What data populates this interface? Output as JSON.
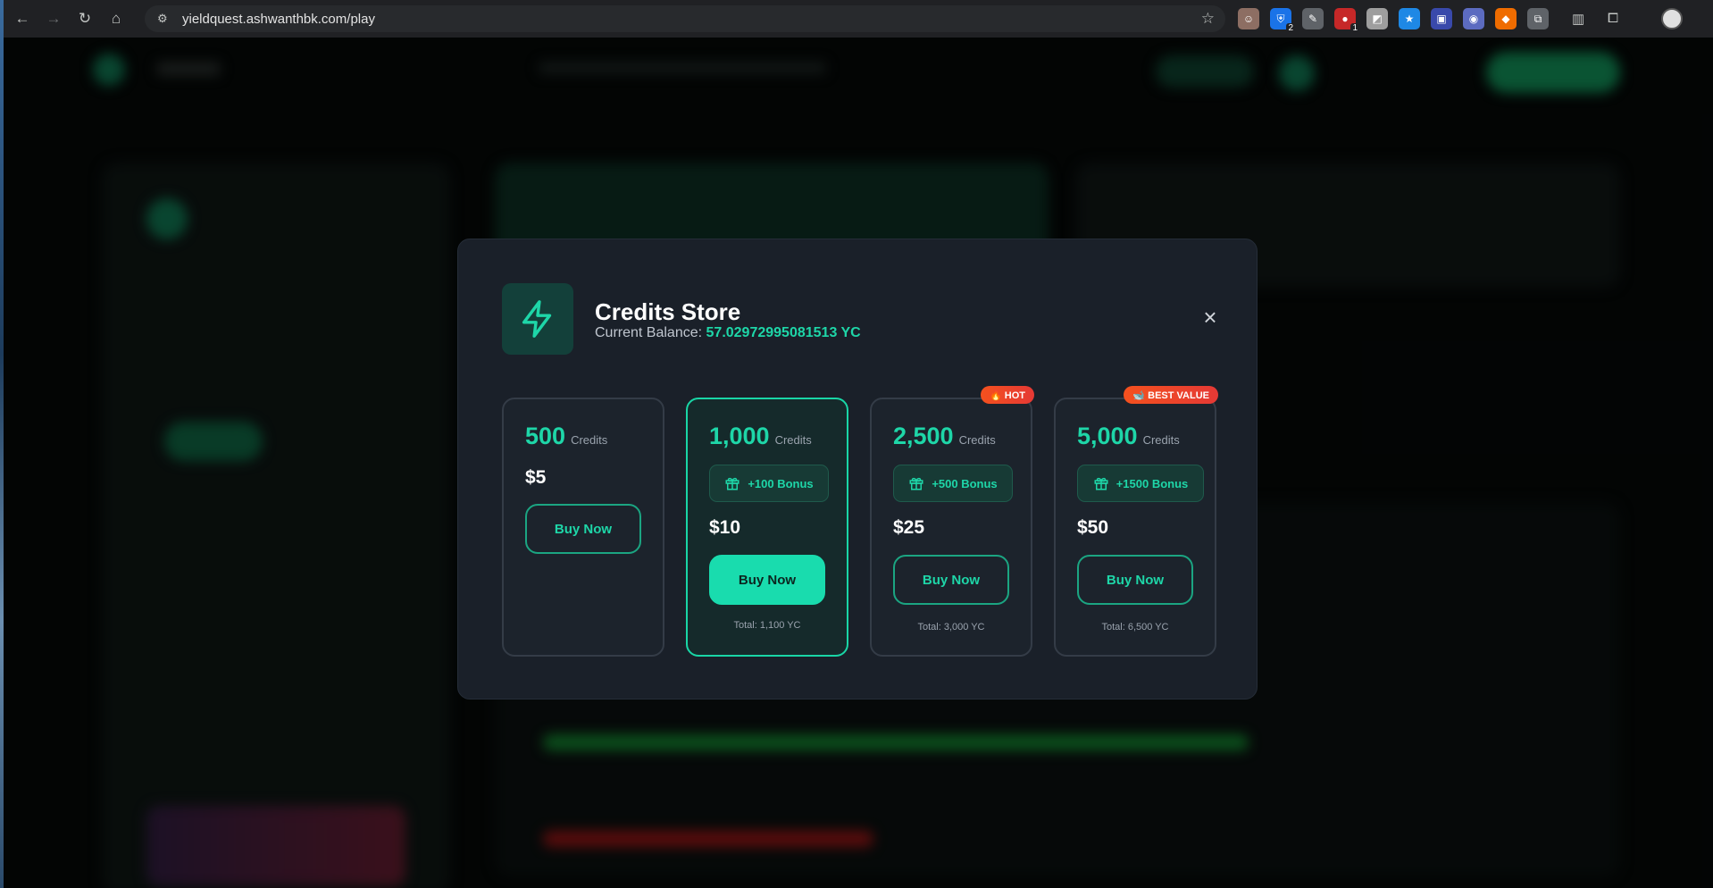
{
  "browser": {
    "url": "yieldquest.ashwanthbk.com/play",
    "extensions": [
      {
        "name": "ext-face",
        "color": "#8d6e63",
        "glyph": "☺"
      },
      {
        "name": "ext-shield",
        "color": "#1a73e8",
        "glyph": "⛨",
        "count": "2"
      },
      {
        "name": "ext-feather",
        "color": "#5f6368",
        "glyph": "✎"
      },
      {
        "name": "ext-red",
        "color": "#c62828",
        "glyph": "●",
        "count": "1"
      },
      {
        "name": "ext-grey",
        "color": "#9e9e9e",
        "glyph": "◩"
      },
      {
        "name": "ext-star",
        "color": "#1e88e5",
        "glyph": "★"
      },
      {
        "name": "ext-folder",
        "color": "#3949ab",
        "glyph": "▣"
      },
      {
        "name": "ext-chat",
        "color": "#5c6bc0",
        "glyph": "◉"
      },
      {
        "name": "ext-fox",
        "color": "#ef6c00",
        "glyph": "◆"
      },
      {
        "name": "ext-puzzle",
        "color": "#5f6368",
        "glyph": "⧉"
      }
    ]
  },
  "modal": {
    "title": "Credits Store",
    "balance_label": "Current Balance:",
    "balance_value": "57.02972995081513 YC",
    "close_glyph": "×"
  },
  "packages": [
    {
      "amount": "500",
      "unit": "Credits",
      "price": "$5",
      "button": "Buy Now"
    },
    {
      "amount": "1,000",
      "unit": "Credits",
      "bonus": "+100 Bonus",
      "price": "$10",
      "button": "Buy Now",
      "total": "Total: 1,100 YC",
      "featured": true
    },
    {
      "amount": "2,500",
      "unit": "Credits",
      "bonus": "+500 Bonus",
      "price": "$25",
      "button": "Buy Now",
      "total": "Total: 3,000 YC",
      "badge": "🔥 HOT"
    },
    {
      "amount": "5,000",
      "unit": "Credits",
      "bonus": "+1500 Bonus",
      "price": "$50",
      "button": "Buy Now",
      "total": "Total: 6,500 YC",
      "badge": "🐋 BEST VALUE"
    }
  ],
  "colors": {
    "accent": "#1ed6a8",
    "modal_bg": "#1a2029",
    "badge": "#f4511e"
  }
}
